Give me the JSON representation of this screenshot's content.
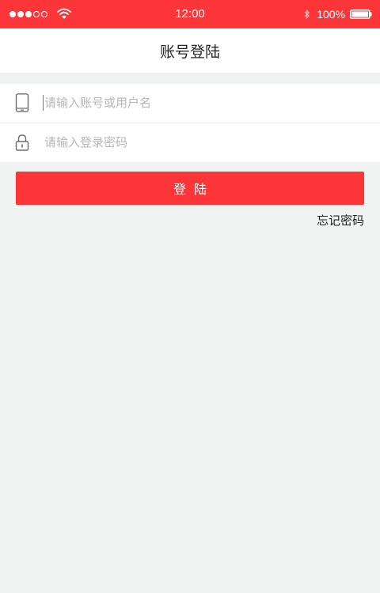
{
  "colors": {
    "accent": "#fc3538",
    "background": "#f0f3f2",
    "placeholder": "#b6b6b6"
  },
  "status_bar": {
    "time": "12:00",
    "battery": "100%",
    "signal_icon": "signal-dots-icon",
    "wifi_icon": "wifi-icon",
    "bluetooth_icon": "bluetooth-icon",
    "battery_icon": "battery-icon"
  },
  "nav": {
    "title": "账号登陆"
  },
  "form": {
    "account": {
      "icon": "phone-icon",
      "placeholder": "请输入账号或用户名",
      "value": ""
    },
    "password": {
      "icon": "lock-icon",
      "placeholder": "请输入登录密码",
      "value": ""
    }
  },
  "actions": {
    "login_label": "登陆",
    "forgot_label": "忘记密码"
  }
}
